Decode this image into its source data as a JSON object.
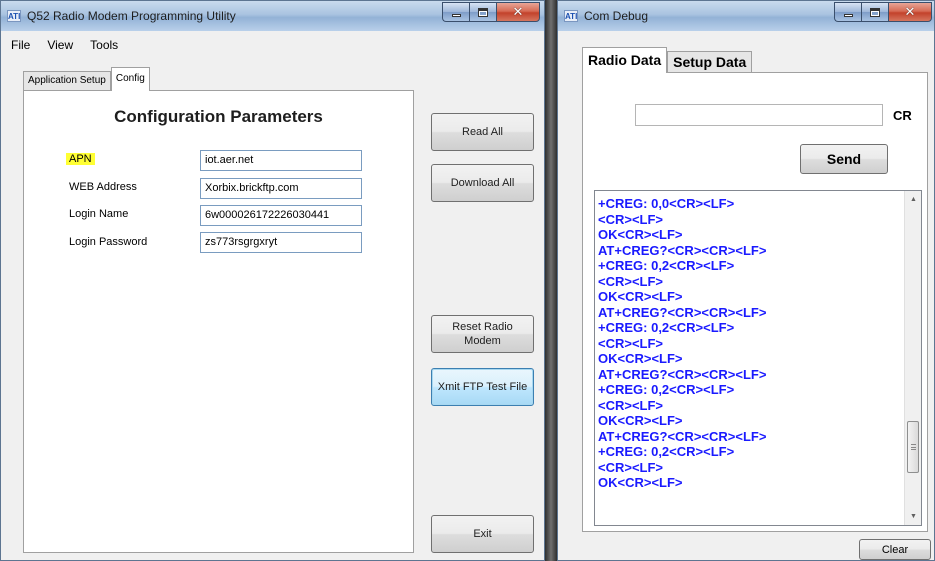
{
  "main_window": {
    "title": "Q52 Radio Modem Programming Utility",
    "logo_text": "ATI",
    "menu": [
      "File",
      "View",
      "Tools"
    ],
    "tabs": [
      {
        "label": "Application Setup",
        "active": false
      },
      {
        "label": "Config",
        "active": true
      }
    ],
    "config": {
      "heading": "Configuration Parameters",
      "fields": [
        {
          "label": "APN",
          "value": "iot.aer.net",
          "highlighted": true
        },
        {
          "label": "WEB Address",
          "value": "Xorbix.brickftp.com",
          "highlighted": false
        },
        {
          "label": "Login Name",
          "value": "6w000026172226030441",
          "highlighted": false
        },
        {
          "label": "Login Password",
          "value": "zs773rsgrgxryt",
          "highlighted": false
        }
      ]
    },
    "buttons": {
      "read_all": "Read All",
      "download_all": "Download All",
      "reset_radio_modem": "Reset Radio Modem",
      "xmit_ftp": "Xmit FTP Test File",
      "exit": "Exit"
    },
    "highlight_color": "#ffff33"
  },
  "debug_window": {
    "title": "Com Debug",
    "logo_text": "ATI",
    "tabs": [
      {
        "label": "Radio Data",
        "active": true
      },
      {
        "label": "Setup Data",
        "active": false
      }
    ],
    "command_input": {
      "value": ""
    },
    "cr_label": "CR",
    "send_label": "Send",
    "clear_label": "Clear",
    "log_color": "#1a1aff",
    "log_lines": [
      "+CREG: 0,0<CR><LF>",
      "<CR><LF>",
      "OK<CR><LF>",
      "AT+CREG?<CR><CR><LF>",
      "+CREG: 0,2<CR><LF>",
      "<CR><LF>",
      "OK<CR><LF>",
      "AT+CREG?<CR><CR><LF>",
      "+CREG: 0,2<CR><LF>",
      "<CR><LF>",
      "OK<CR><LF>",
      "AT+CREG?<CR><CR><LF>",
      "+CREG: 0,2<CR><LF>",
      "<CR><LF>",
      "OK<CR><LF>",
      "AT+CREG?<CR><CR><LF>",
      "+CREG: 0,2<CR><LF>",
      "<CR><LF>",
      "OK<CR><LF>"
    ],
    "scroll_position": 0.85
  }
}
